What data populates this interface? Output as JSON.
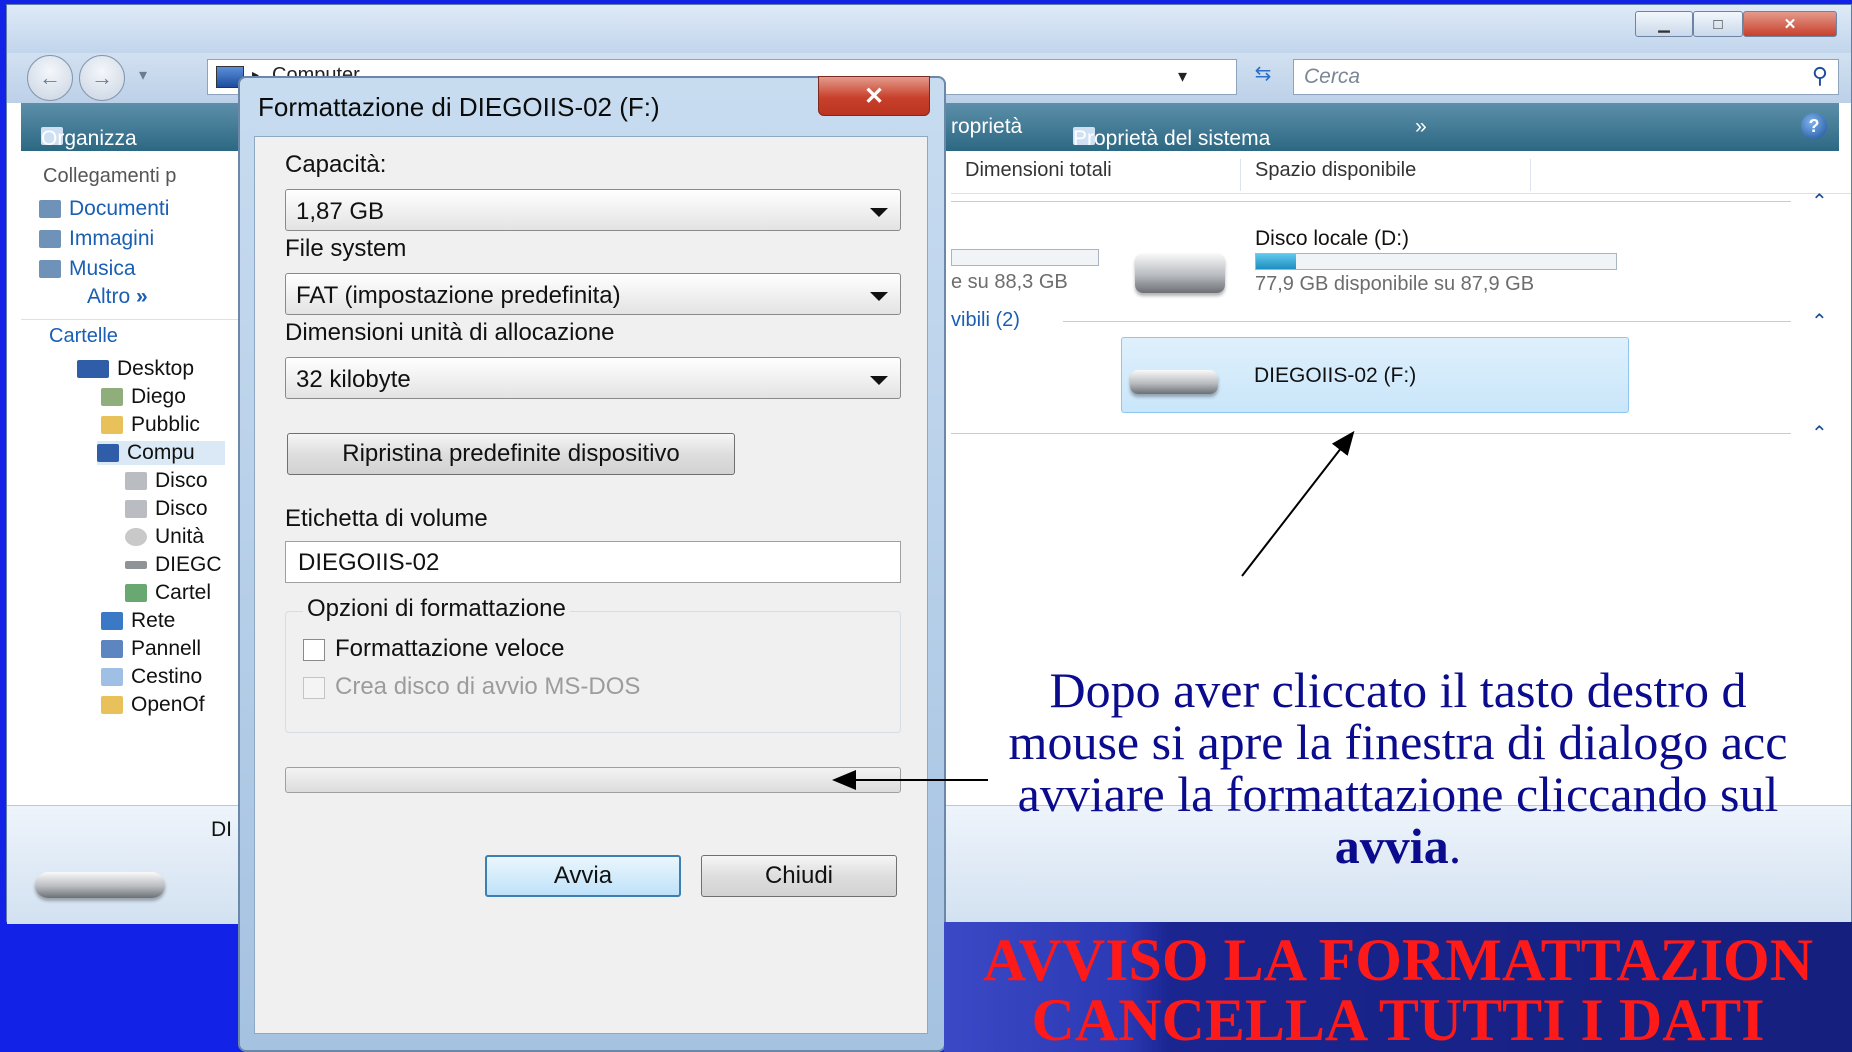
{
  "explorer": {
    "breadcrumb": "Computer",
    "search_placeholder": "Cerca",
    "toolbar": {
      "organize": "Organizza",
      "properties": "roprietà",
      "system_properties": "Proprietà del sistema",
      "more": "»"
    },
    "sidebar": {
      "links_header": "Collegamenti p",
      "links": [
        "Documenti",
        "Immagini",
        "Musica"
      ],
      "more_label": "Altro",
      "folders_header": "Cartelle",
      "tree": [
        "Desktop",
        "Diego",
        "Pubblic",
        "Compu",
        "Disco",
        "Disco",
        "Unità",
        "DIEGC",
        "Cartel",
        "Rete",
        "Pannell",
        "Cestino",
        "OpenOf"
      ]
    },
    "columns": [
      "Dimensioni totali",
      "Spazio disponibile"
    ],
    "partial_free_text": "e su 88,3 GB",
    "removable_group_label": "vibili (2)",
    "drive_d": {
      "name": "Disco locale (D:)",
      "free_text": "77,9 GB disponibile su 87,9 GB",
      "used_fraction": 0.11
    },
    "drive_f": {
      "name": "DIEGOIIS-02 (F:)"
    },
    "details_label": "DI"
  },
  "dialog": {
    "title": "Formattazione di DIEGOIIS-02 (F:)",
    "capacity_label": "Capacità:",
    "capacity_value": "1,87 GB",
    "filesystem_label": "File system",
    "filesystem_value": "FAT (impostazione predefinita)",
    "allocation_label": "Dimensioni unità di allocazione",
    "allocation_value": "32 kilobyte",
    "restore_button": "Ripristina predefinite dispositivo",
    "volume_label_label": "Etichetta di volume",
    "volume_label_value": "DIEGOIIS-02",
    "options_group": "Opzioni di formattazione",
    "quick_format": "Formattazione veloce",
    "msdos_disk": "Crea disco di avvio MS-DOS",
    "start_button": "Avvia",
    "close_button": "Chiudi"
  },
  "caption": {
    "line1": "Dopo aver cliccato  il tasto destro d",
    "line2": "mouse si apre la finestra di dialogo acc",
    "line3": "avviare la formattazione cliccando sul",
    "bold_word": "avvia",
    "end": "."
  },
  "warning": {
    "line1": "AVVISO LA FORMATTAZION",
    "line2": "CANCELLA TUTTI I DATI"
  },
  "colors": {
    "background": "#1222e6",
    "caption_text": "#0b0b8e",
    "warning_text": "#ff1a1a"
  }
}
